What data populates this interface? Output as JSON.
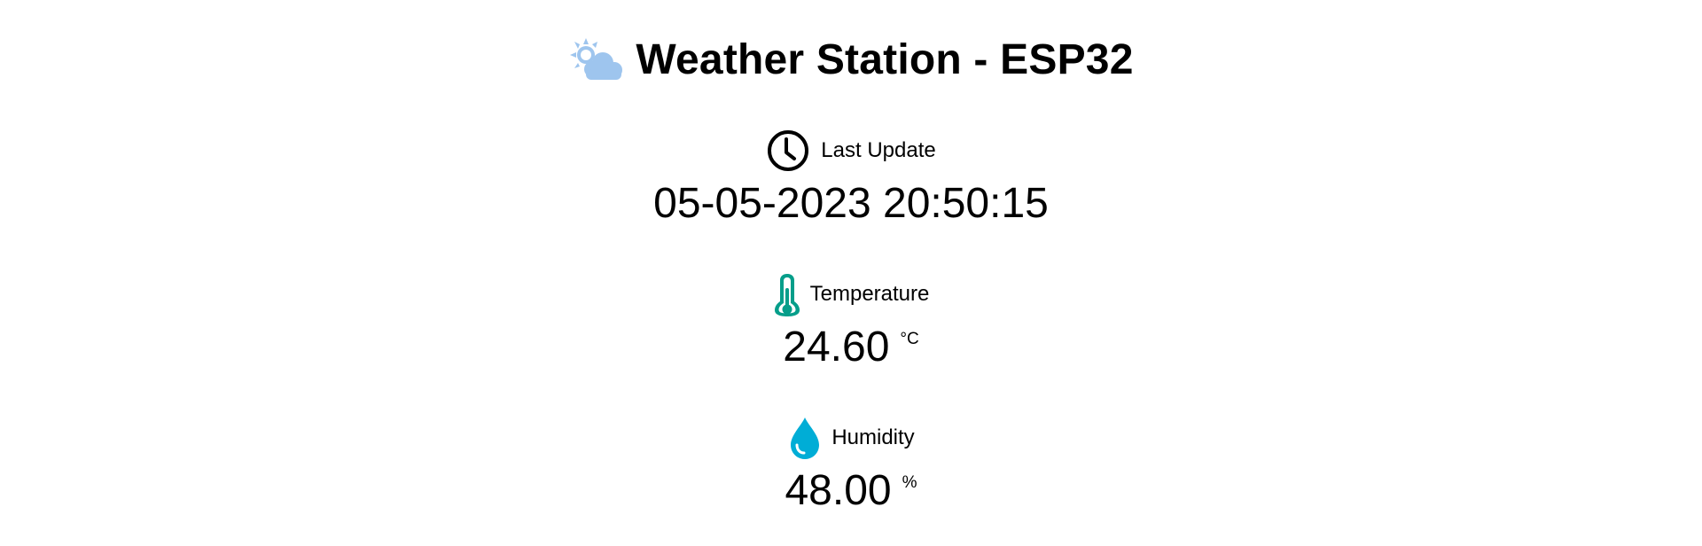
{
  "header": {
    "title": "Weather Station - ESP32",
    "icon": "sun-cloud-icon"
  },
  "cards": {
    "last_update": {
      "label": "Last Update",
      "value": "05-05-2023 20:50:15",
      "icon": "clock-icon"
    },
    "temperature": {
      "label": "Temperature",
      "value": "24.60",
      "unit": "°C",
      "icon": "thermometer-icon"
    },
    "humidity": {
      "label": "Humidity",
      "value": "48.00",
      "unit": "%",
      "icon": "water-drop-icon"
    }
  },
  "colors": {
    "weather_icon": "#9ec5ee",
    "thermometer": "#059e8a",
    "drop": "#00add6",
    "text": "#000000",
    "background": "#ffffff"
  }
}
